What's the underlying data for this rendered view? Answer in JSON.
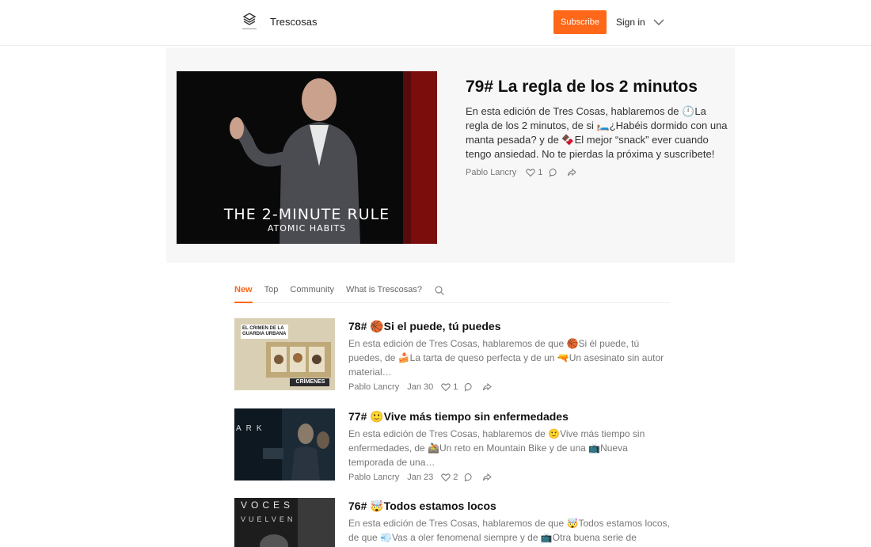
{
  "header": {
    "site_name": "Trescosas",
    "subscribe_label": "Subscribe",
    "signin_label": "Sign in"
  },
  "hero": {
    "title": "79# La regla de los 2 minutos",
    "description": "En esta edición de Tres Cosas, hablaremos de 🕛La regla de los 2 minutos, de si 🛏️¿Habéis dormido con una manta pesada? y de 🍫El mejor “snack” ever cuando tengo ansiedad. No te pierdas la próxima y suscríbete!",
    "author": "Pablo Lancry",
    "likes": "1",
    "image_caption_line1": "THE 2-MINUTE RULE",
    "image_caption_line2": "ATOMIC HABITS"
  },
  "tabs": [
    {
      "label": "New"
    },
    {
      "label": "Top"
    },
    {
      "label": "Community"
    },
    {
      "label": "What is Trescosas?"
    }
  ],
  "posts": [
    {
      "title": "78# 🏀Si el puede, tú puedes",
      "description": "En esta edición de Tres Cosas, hablaremos de que 🏀Si él puede, tú puedes, de 🍰La tarta de queso perfecta y de un 🔫Un asesinato sin autor material…",
      "author": "Pablo Lancry",
      "date": "Jan 30",
      "likes": "1",
      "thumb_text1": "EL CRIMEN DE LA GUARDIA URBANA",
      "thumb_text2": "CRÍMENES"
    },
    {
      "title": "77# 🙂Vive más tiempo sin enfermedades",
      "description": "En esta edición de Tres Cosas, hablaremos de 🙂Vive más tiempo sin enfermedades, de 🚵Un reto en Mountain Bike y de una 📺Nueva temporada de una…",
      "author": "Pablo Lancry",
      "date": "Jan 23",
      "likes": "2",
      "thumb_text1": "ARK"
    },
    {
      "title": "76# 🤯Todos estamos locos",
      "description": "En esta edición de Tres Cosas, hablaremos de que 🤯Todos estamos locos, de que 💨Vas a oler fenomenal siempre y de 📺Otra buena serie de",
      "thumb_text1": "VOCES",
      "thumb_text2": "VUELVEN"
    }
  ],
  "colors": {
    "accent": "#ff6719"
  }
}
